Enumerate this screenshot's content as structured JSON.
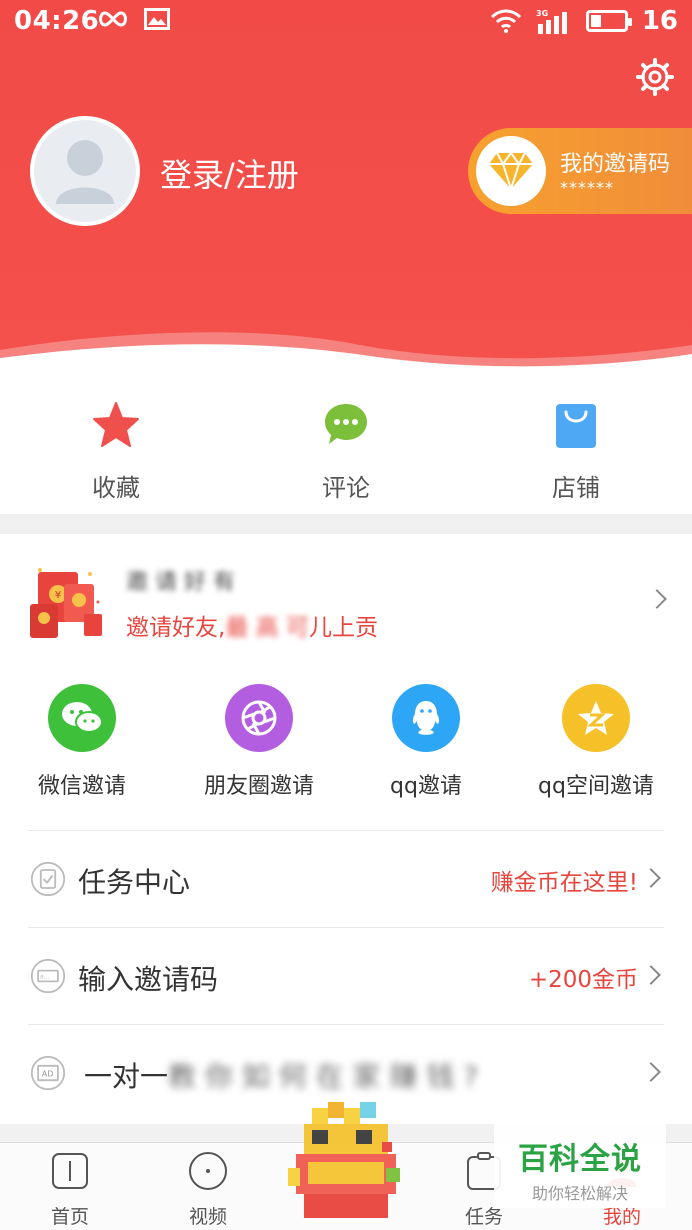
{
  "status_bar": {
    "time": "04:26",
    "network": "3G",
    "battery": "16"
  },
  "header": {
    "login_text": "登录/注册",
    "invite_title": "我的邀请码",
    "invite_code": "******"
  },
  "quick_actions": [
    {
      "label": "收藏",
      "icon": "star-icon",
      "color": "#f0504b"
    },
    {
      "label": "评论",
      "icon": "comment-icon",
      "color": "#7cbf3a"
    },
    {
      "label": "店铺",
      "icon": "shopping-bag-icon",
      "color": "#4fa8f4"
    }
  ],
  "promo": {
    "title": "邀 请 好 有",
    "subtitle_visible": "邀请好友,",
    "subtitle_blur": "最 高 可",
    "subtitle_end": "儿上贡"
  },
  "share": [
    {
      "label": "微信邀请",
      "icon": "wechat-icon",
      "color": "#3ec03a"
    },
    {
      "label": "朋友圈邀请",
      "icon": "moments-icon",
      "color": "#b35ee0"
    },
    {
      "label": "qq邀请",
      "icon": "qq-icon",
      "color": "#2ea6f6"
    },
    {
      "label": "qq空间邀请",
      "icon": "qzone-icon",
      "color": "#f5c028"
    }
  ],
  "rows": [
    {
      "label": "任务中心",
      "value": "赚金币在这里!",
      "icon": "task-icon"
    },
    {
      "label": "输入邀请码",
      "value": "+200金币",
      "icon": "invite-code-icon"
    },
    {
      "label": "一对一",
      "blurred": "教 你 如 何 在 家 赚 钱 ?",
      "value": "",
      "icon": "ad-icon"
    }
  ],
  "bottom_nav": [
    {
      "label": "首页",
      "icon": "home-icon"
    },
    {
      "label": "视频",
      "icon": "video-icon"
    },
    {
      "label": "任务",
      "icon": "task-nav-icon"
    },
    {
      "label": "我的",
      "icon": "profile-icon"
    }
  ],
  "watermark": {
    "title": "百科全说",
    "subtitle": "助你轻松解决"
  },
  "colors": {
    "header_red": "#f24b47",
    "accent_red": "#e7463f",
    "invite_orange": "#f7a12e"
  }
}
